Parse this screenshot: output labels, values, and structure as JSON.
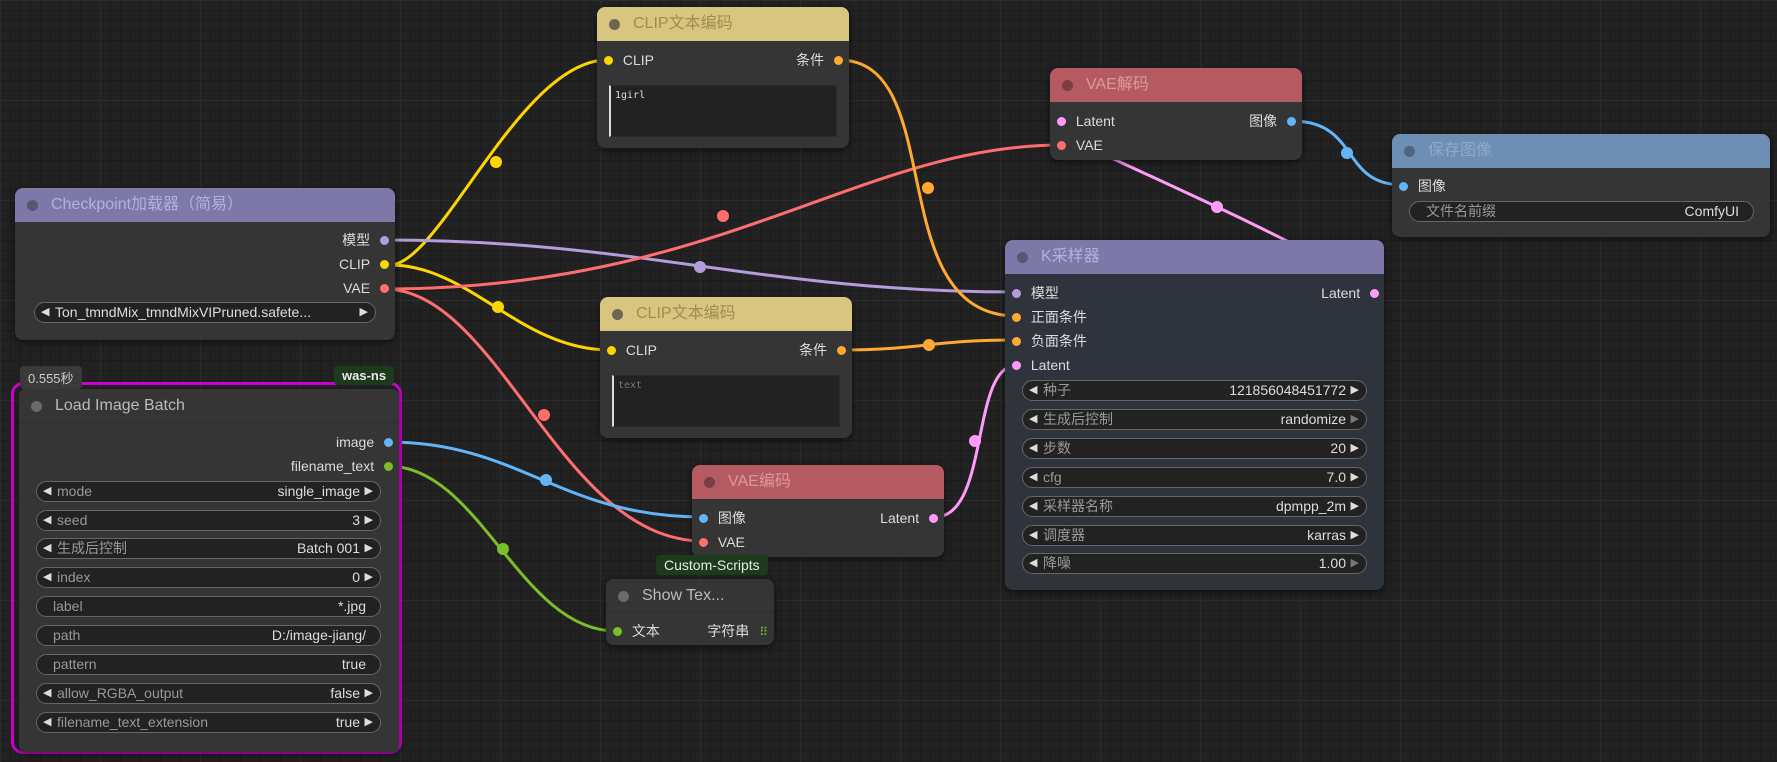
{
  "colors": {
    "clip": "#ffd500",
    "conditioning": "#ffa931",
    "vae": "#ff6e6e",
    "model": "#b39ddb",
    "latent": "#ff9cf9",
    "image": "#64b5f6",
    "string": "#7cbd2a",
    "group_outline": "#d000d0"
  },
  "nodes": {
    "clip_text_1": {
      "title": "CLIP文本编码",
      "inputs": [
        "CLIP"
      ],
      "outputs": [
        "条件"
      ],
      "text": "1girl"
    },
    "clip_text_2": {
      "title": "CLIP文本编码",
      "inputs": [
        "CLIP"
      ],
      "outputs": [
        "条件"
      ],
      "placeholder": "text"
    },
    "checkpoint": {
      "title": "Checkpoint加载器（简易）",
      "outputs": [
        "模型",
        "CLIP",
        "VAE"
      ],
      "ckpt_value": "Ton_tmndMix_tmndMixVIPruned.safete..."
    },
    "vae_decode": {
      "title": "VAE解码",
      "inputs": [
        "Latent",
        "VAE"
      ],
      "outputs": [
        "图像"
      ]
    },
    "save_image": {
      "title": "保存图像",
      "inputs": [
        "图像"
      ],
      "prefix_label": "文件名前缀",
      "prefix_value": "ComfyUI"
    },
    "ksampler": {
      "title": "K采样器",
      "inputs": [
        "模型",
        "正面条件",
        "负面条件",
        "Latent"
      ],
      "outputs": [
        "Latent"
      ],
      "widgets": [
        {
          "label": "种子",
          "value": "121856048451772"
        },
        {
          "label": "生成后控制",
          "value": "randomize"
        },
        {
          "label": "步数",
          "value": "20"
        },
        {
          "label": "cfg",
          "value": "7.0"
        },
        {
          "label": "采样器名称",
          "value": "dpmpp_2m"
        },
        {
          "label": "调度器",
          "value": "karras"
        },
        {
          "label": "降噪",
          "value": "1.00"
        }
      ]
    },
    "vae_encode": {
      "title": "VAE编码",
      "inputs": [
        "图像",
        "VAE"
      ],
      "outputs": [
        "Latent"
      ]
    },
    "show_text": {
      "title": "Show Tex...",
      "badge": "Custom-Scripts",
      "inputs": [
        "文本"
      ],
      "outputs": [
        "字符串"
      ]
    },
    "load_image_batch": {
      "title": "Load Image Batch",
      "time": "0.555秒",
      "badge": "was-ns",
      "outputs": [
        "image",
        "filename_text"
      ],
      "widgets": [
        {
          "label": "mode",
          "value": "single_image"
        },
        {
          "label": "seed",
          "value": "3"
        },
        {
          "label": "生成后控制",
          "value": "Batch 001"
        },
        {
          "label": "index",
          "value": "0"
        },
        {
          "label": "label",
          "value": "*.jpg"
        },
        {
          "label": "path",
          "value": "D:/image-jiang/"
        },
        {
          "label": "pattern",
          "value": "true"
        },
        {
          "label": "allow_RGBA_output",
          "value": "false"
        },
        {
          "label": "filename_text_extension",
          "value": "true"
        }
      ]
    }
  }
}
